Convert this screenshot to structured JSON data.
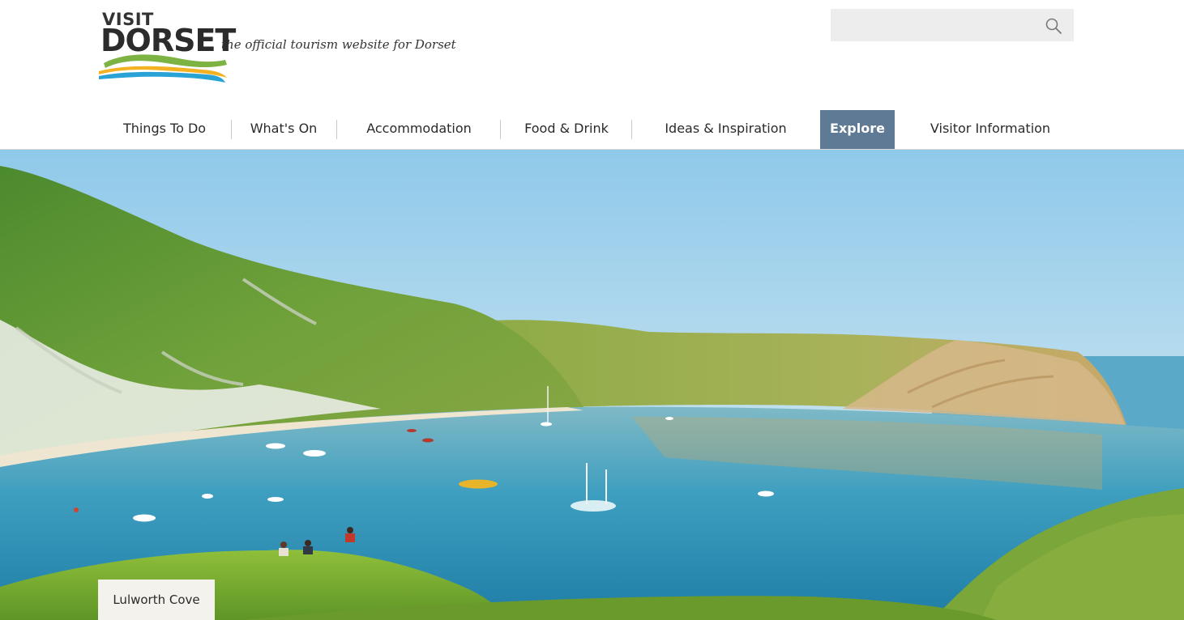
{
  "logo": {
    "visit": "VISIT",
    "name": "DORSET",
    "tagline": "the official tourism website for Dorset"
  },
  "search": {
    "placeholder": "",
    "value": "",
    "icon": "search-icon"
  },
  "nav": {
    "items": [
      {
        "label": "Things To Do",
        "active": false
      },
      {
        "label": "What's On",
        "active": false
      },
      {
        "label": "Accommodation",
        "active": false
      },
      {
        "label": "Food & Drink",
        "active": false
      },
      {
        "label": "Ideas & Inspiration",
        "active": false
      },
      {
        "label": "Explore",
        "active": true
      },
      {
        "label": "Visitor Information",
        "active": false
      }
    ],
    "active_color": "#5f7a94"
  },
  "hero": {
    "caption": "Lulworth Cove"
  }
}
